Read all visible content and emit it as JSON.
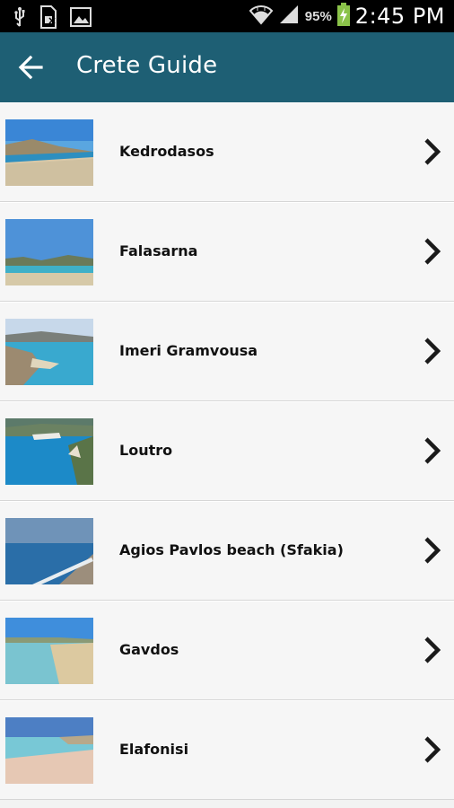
{
  "status_bar": {
    "battery_percent": "95%",
    "time": "2:45 PM",
    "icons": [
      "usb-icon",
      "sim-icon",
      "image-icon",
      "wifi-icon",
      "signal-icon",
      "battery-charging-icon"
    ]
  },
  "app_bar": {
    "title": "Crete Guide",
    "back_icon": "arrow-left-icon",
    "background": "#1e5f74"
  },
  "list": {
    "items": [
      {
        "label": "Kedrodasos"
      },
      {
        "label": "Falasarna"
      },
      {
        "label": "Imeri Gramvousa"
      },
      {
        "label": "Loutro"
      },
      {
        "label": "Agios Pavlos beach (Sfakia)"
      },
      {
        "label": "Gavdos"
      },
      {
        "label": "Elafonisi"
      }
    ],
    "chevron_icon": "chevron-right-icon"
  }
}
